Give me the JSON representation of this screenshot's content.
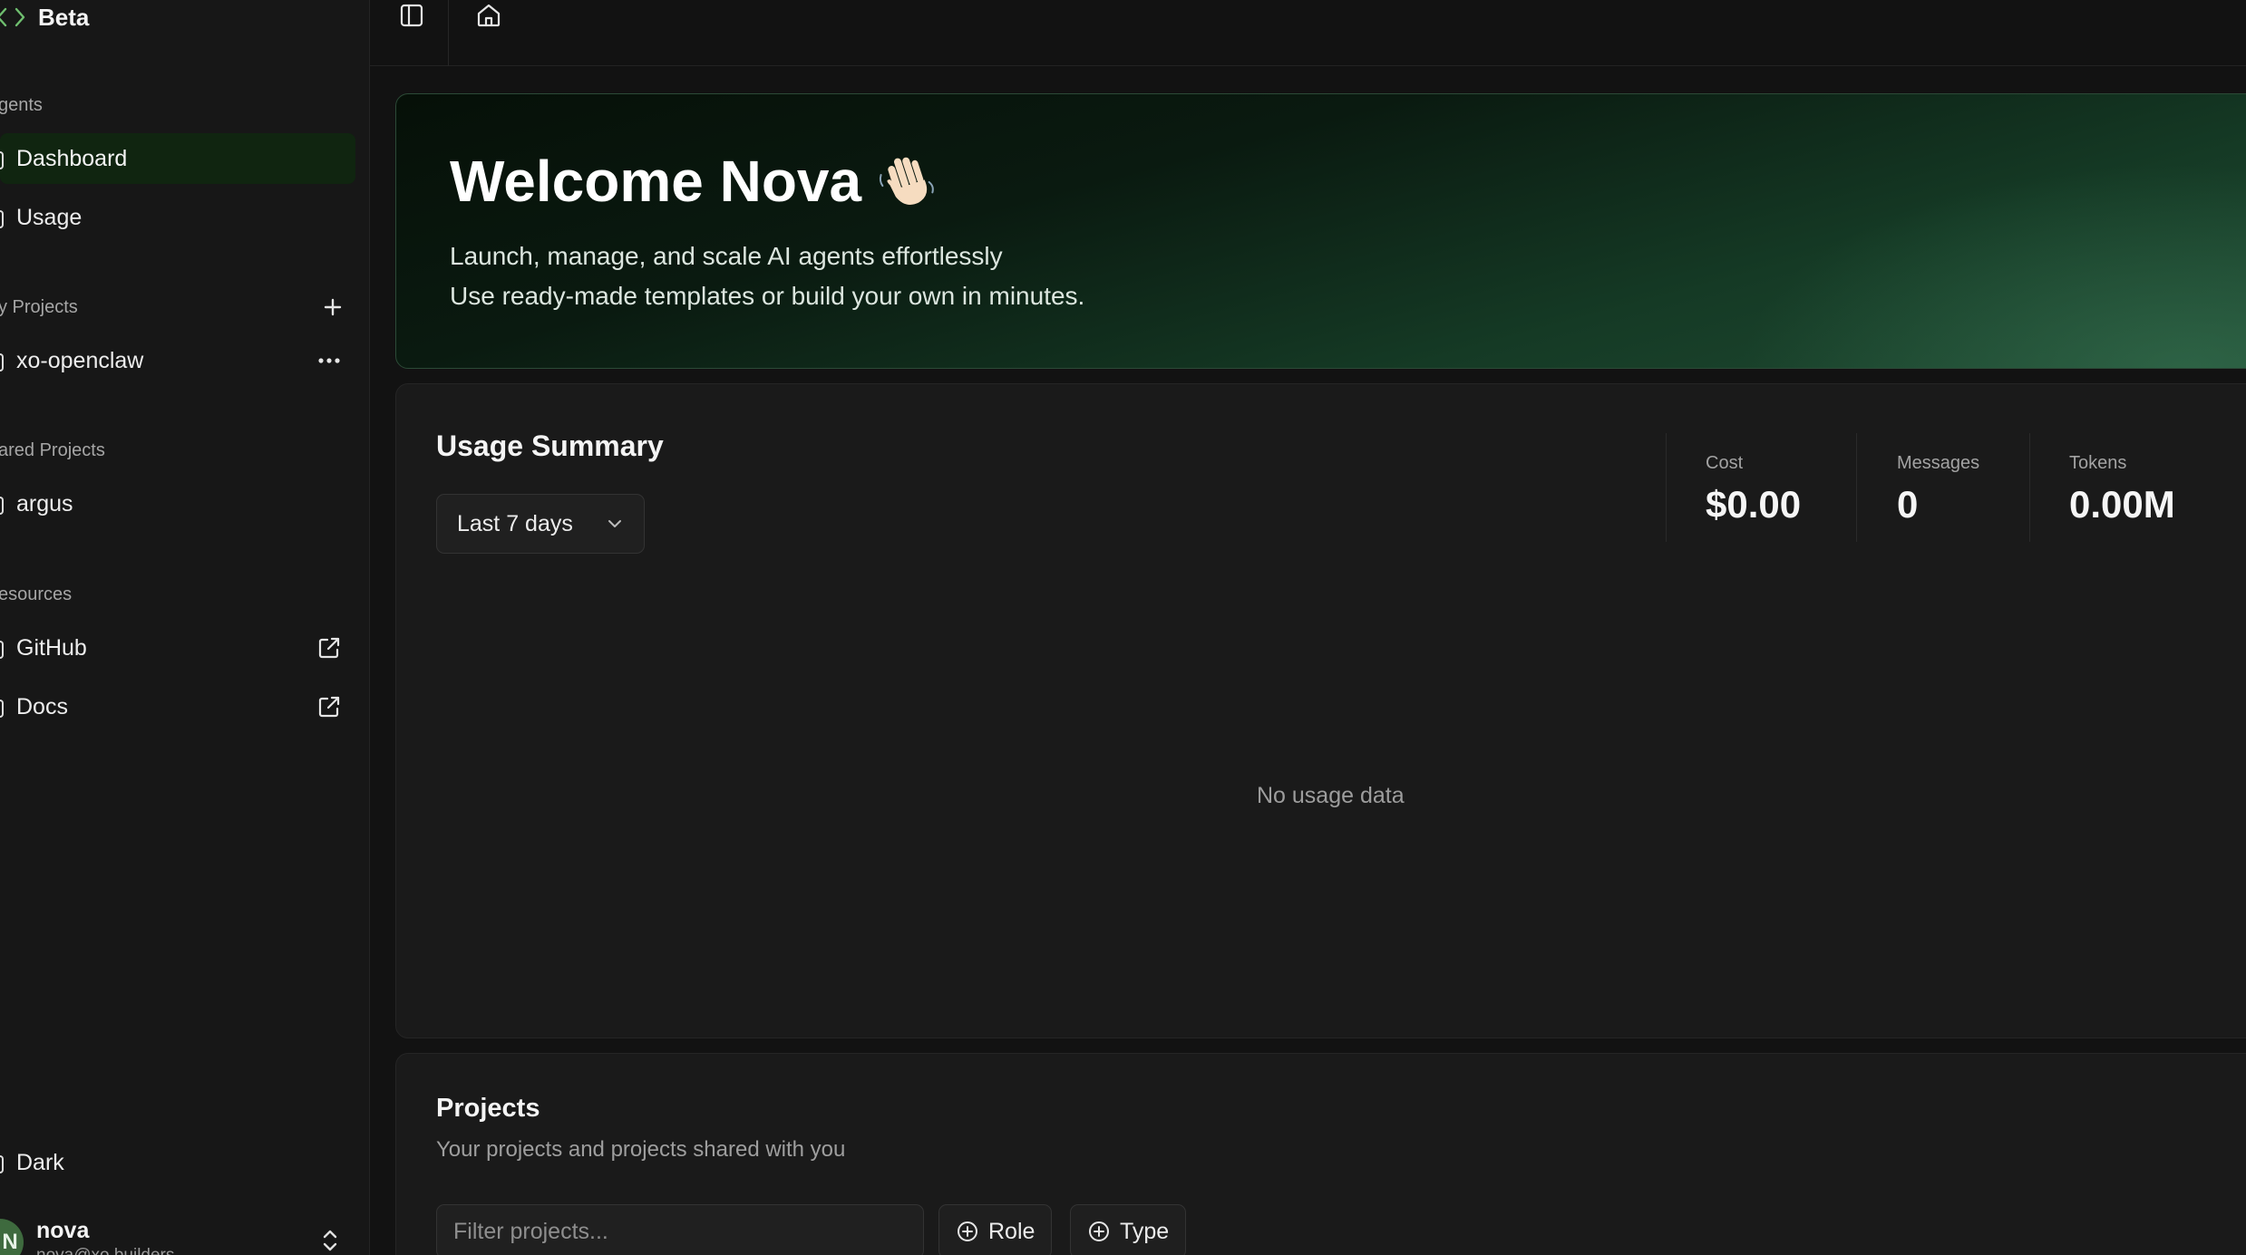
{
  "brand": {
    "name": "Beta"
  },
  "sidebar": {
    "sections": {
      "agents": "gents",
      "my_projects": "y Projects",
      "shared_projects": "ared Projects",
      "resources": "esources"
    },
    "items": {
      "dashboard": "Dashboard",
      "usage": "Usage",
      "project_1": "xo-openclaw",
      "shared_1": "argus",
      "github": "GitHub",
      "docs": "Docs",
      "theme": "Dark"
    },
    "user": {
      "initial": "N",
      "name": "nova",
      "email": "nova@xo.builders"
    }
  },
  "hero": {
    "title": "Welcome Nova",
    "line1": "Launch, manage, and scale AI agents effortlessly",
    "line2": "Use ready-made templates or build your own in minutes."
  },
  "usage": {
    "title": "Usage Summary",
    "range": "Last 7 days",
    "stats": [
      {
        "label": "Cost",
        "value": "$0.00"
      },
      {
        "label": "Messages",
        "value": "0"
      },
      {
        "label": "Tokens",
        "value": "0.00M"
      }
    ],
    "empty": "No usage data"
  },
  "projects": {
    "title": "Projects",
    "subtitle": "Your projects and projects shared with you",
    "filter_placeholder": "Filter projects...",
    "chips": {
      "role": "Role",
      "type": "Type"
    }
  },
  "colors": {
    "accent": "#1f4a32",
    "active_bg": "#102510",
    "background": "#121212"
  }
}
